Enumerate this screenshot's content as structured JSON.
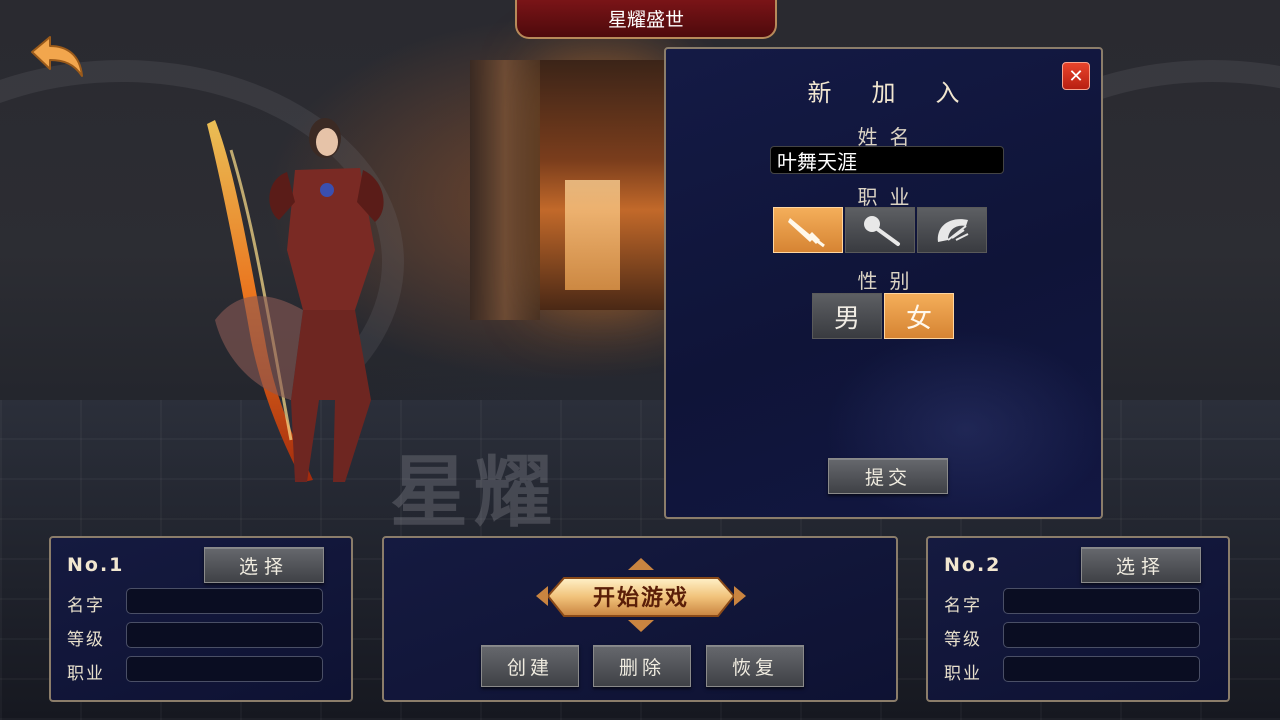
{
  "header": {
    "title": "星耀盛世"
  },
  "background": {
    "watermark": "星耀"
  },
  "create_dialog": {
    "title": "新加入",
    "close_icon": "close-icon",
    "name_label": "姓名",
    "name_value": "叶舞天涯",
    "job_label": "职业",
    "jobs": [
      {
        "icon": "sword-icon",
        "selected": true
      },
      {
        "icon": "staff-icon",
        "selected": false
      },
      {
        "icon": "fan-icon",
        "selected": false
      }
    ],
    "gender_label": "性别",
    "genders": [
      {
        "label": "男",
        "selected": false
      },
      {
        "label": "女",
        "selected": true
      }
    ],
    "submit_label": "提交",
    "accent_color": "#e89a45"
  },
  "slots": [
    {
      "number": "No.1",
      "select_label": "选择",
      "name_label": "名字",
      "level_label": "等级",
      "job_label": "职业",
      "name": "",
      "level": "",
      "job": ""
    },
    {
      "number": "No.2",
      "select_label": "选择",
      "name_label": "名字",
      "level_label": "等级",
      "job_label": "职业",
      "name": "",
      "level": "",
      "job": ""
    }
  ],
  "center_panel": {
    "start_label": "开始游戏",
    "create_label": "创建",
    "delete_label": "删除",
    "restore_label": "恢复"
  }
}
